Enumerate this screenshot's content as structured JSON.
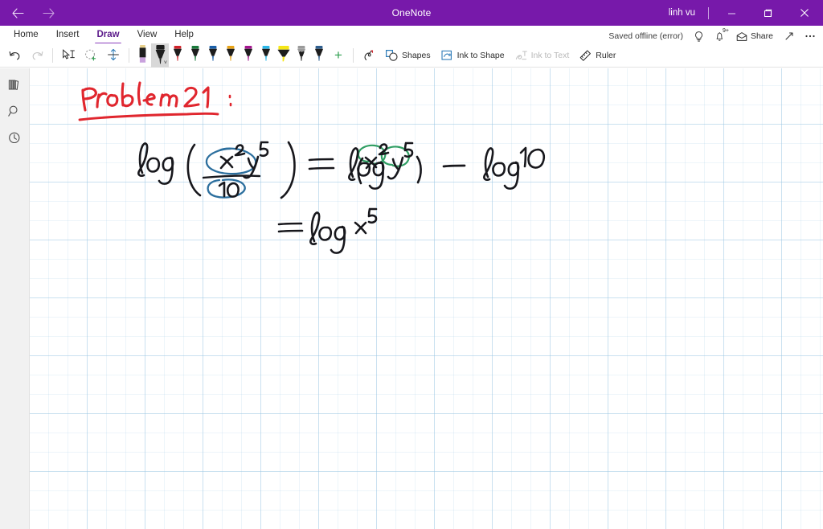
{
  "window": {
    "app_title": "OneNote",
    "user": "linh vu",
    "back_icon": "back-arrow-icon",
    "forward_icon": "forward-arrow-icon",
    "minimize_label": "Minimize",
    "restore_label": "Restore",
    "close_label": "Close"
  },
  "ribbon": {
    "tabs": [
      {
        "label": "Home",
        "active": false
      },
      {
        "label": "Insert",
        "active": false
      },
      {
        "label": "Draw",
        "active": true
      },
      {
        "label": "View",
        "active": false
      },
      {
        "label": "Help",
        "active": false
      }
    ],
    "save_status": "Saved offline (error)",
    "tell_me_icon": "lightbulb-icon",
    "notifications_icon": "bell-icon",
    "notifications_badge": "9+",
    "share_label": "Share",
    "share_icon": "share-icon",
    "expand_icon": "diagonal-expand-icon",
    "more_icon": "ellipsis-icon"
  },
  "toolbar": {
    "undo_label": "Undo",
    "redo_label": "Redo",
    "select_label": "Type / Select",
    "lasso_label": "Lasso Select",
    "insert_space_label": "Insert Space",
    "add_pen_label": "+",
    "ink_replay_label": "Ink Replay",
    "shapes_label": "Shapes",
    "ink_to_shape_label": "Ink to Shape",
    "ink_to_text_label": "Ink to Text",
    "ruler_label": "Ruler",
    "pens": [
      {
        "name": "highlighter-lavender",
        "color": "#c9a2dd",
        "cap": "#e8d08a",
        "type": "highlighter",
        "selected": false
      },
      {
        "name": "pen-black",
        "color": "#1a1a1a",
        "cap": "#1a1a1a",
        "type": "pen-wide",
        "selected": true
      },
      {
        "name": "pen-red",
        "color": "#d0232b",
        "cap": "#d0232b",
        "type": "pen",
        "selected": false
      },
      {
        "name": "pen-green",
        "color": "#1a7a3c",
        "cap": "#1a7a3c",
        "type": "pen",
        "selected": false
      },
      {
        "name": "pen-blue",
        "color": "#1a5fa8",
        "cap": "#1a5fa8",
        "type": "pen",
        "selected": false
      },
      {
        "name": "pen-orange",
        "color": "#e8a317",
        "cap": "#e8a317",
        "type": "pen",
        "selected": false
      },
      {
        "name": "pen-magenta",
        "color": "#a4168f",
        "cap": "#a4168f",
        "type": "pen",
        "selected": false
      },
      {
        "name": "pen-cyan",
        "color": "#2bb7e8",
        "cap": "#2bb7e8",
        "type": "pen",
        "selected": false
      },
      {
        "name": "highlighter-yellow",
        "color": "#f5e618",
        "cap": "#f5e618",
        "type": "highlighter-wide",
        "selected": false
      },
      {
        "name": "pencil-gray",
        "color": "#9a9a9a",
        "cap": "#9a9a9a",
        "type": "pencil",
        "selected": false
      },
      {
        "name": "pen-navy",
        "color": "#2f5f8f",
        "cap": "#2f5f8f",
        "type": "pen",
        "selected": false
      }
    ]
  },
  "rail": {
    "items": [
      {
        "name": "notebooks-icon",
        "label": "Notebooks"
      },
      {
        "name": "search-icon",
        "label": "Search"
      },
      {
        "name": "recent-notes-icon",
        "label": "Recent Notes"
      }
    ]
  },
  "canvas": {
    "ink_notes": [
      {
        "name": "heading",
        "text": "Problem 21 :",
        "color": "#e0262e",
        "note": "red handwriting with underline"
      },
      {
        "name": "line-1-left",
        "text": "log ( x^2 y^5 / 10 )",
        "color": "#1a1a1a"
      },
      {
        "name": "line-1-equals",
        "text": "=",
        "color": "#1a1a1a"
      },
      {
        "name": "line-1-right",
        "text": "log ( x^2 y^5 ) - log 10",
        "color": "#1a1a1a"
      },
      {
        "name": "line-2",
        "text": "= log x^5",
        "color": "#1a1a1a"
      },
      {
        "name": "annotation-blue-numerator",
        "text": "circle around x^2 y^5",
        "color": "#2c6f9e"
      },
      {
        "name": "annotation-blue-denominator",
        "text": "circle around 10",
        "color": "#2c6f9e"
      },
      {
        "name": "annotation-green-x2",
        "text": "circle around x^2",
        "color": "#2f9e63"
      },
      {
        "name": "annotation-green-y5",
        "text": "circle around y^5",
        "color": "#2f9e63"
      }
    ]
  },
  "colors": {
    "titlebar": "#7719aa",
    "accent": "#8b40bd",
    "grid": "#96c3e1",
    "rail_bg": "#f1f1f1"
  }
}
